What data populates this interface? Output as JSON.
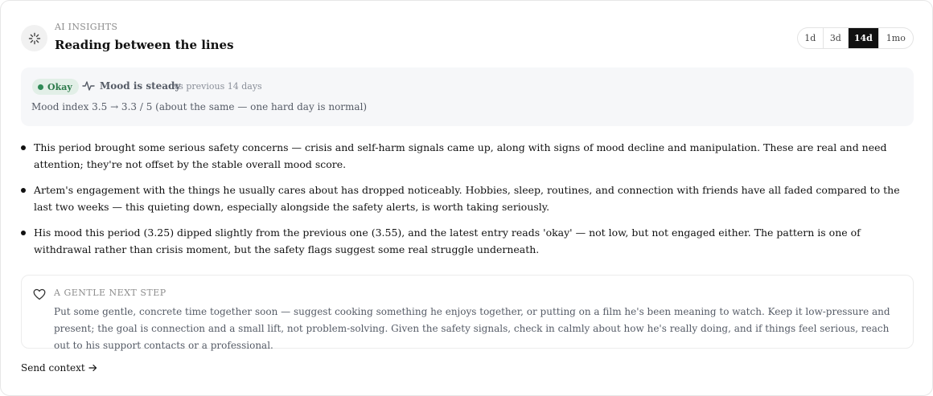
{
  "header": {
    "icon": "sparkle-loader-icon",
    "eyebrow": "AI INSIGHTS",
    "title": "Reading between the lines"
  },
  "range": {
    "options": [
      "1d",
      "3d",
      "14d",
      "1mo"
    ],
    "selected": "14d"
  },
  "mood": {
    "status_badge": "Okay",
    "status_color": "#2f8a56",
    "icon": "pulse-icon",
    "label": "Mood is steady",
    "compare": "vs previous 14 days",
    "index_text": "Mood index 3.5 → 3.3 / 5 (about the same — one hard day is normal)"
  },
  "insights": [
    "This period brought some serious safety concerns — crisis and self-harm signals came up, along with signs of mood decline and manipulation. These are real and need attention; they're not offset by the stable overall mood score.",
    "Artem's engagement with the things he usually cares about has dropped noticeably. Hobbies, sleep, routines, and connection with friends have all faded compared to the last two weeks — this quieting down, especially alongside the safety alerts, is worth taking seriously.",
    "His mood this period (3.25) dipped slightly from the previous one (3.55), and the latest entry reads 'okay' — not low, but not engaged either. The pattern is one of withdrawal rather than crisis moment, but the safety flags suggest some real struggle underneath."
  ],
  "next_step": {
    "icon": "heart-icon",
    "label": "A GENTLE NEXT STEP",
    "text": "Put some gentle, concrete time together soon — suggest cooking something he enjoys together, or putting on a film he's been meaning to watch. Keep it low-pressure and present; the goal is connection and a small lift, not problem-solving. Given the safety signals, check in calmly about how he's really doing, and if things feel serious, reach out to his support contacts or a professional."
  },
  "footer": {
    "send_context_label": "Send context",
    "arrow_icon": "arrow-right-icon"
  }
}
